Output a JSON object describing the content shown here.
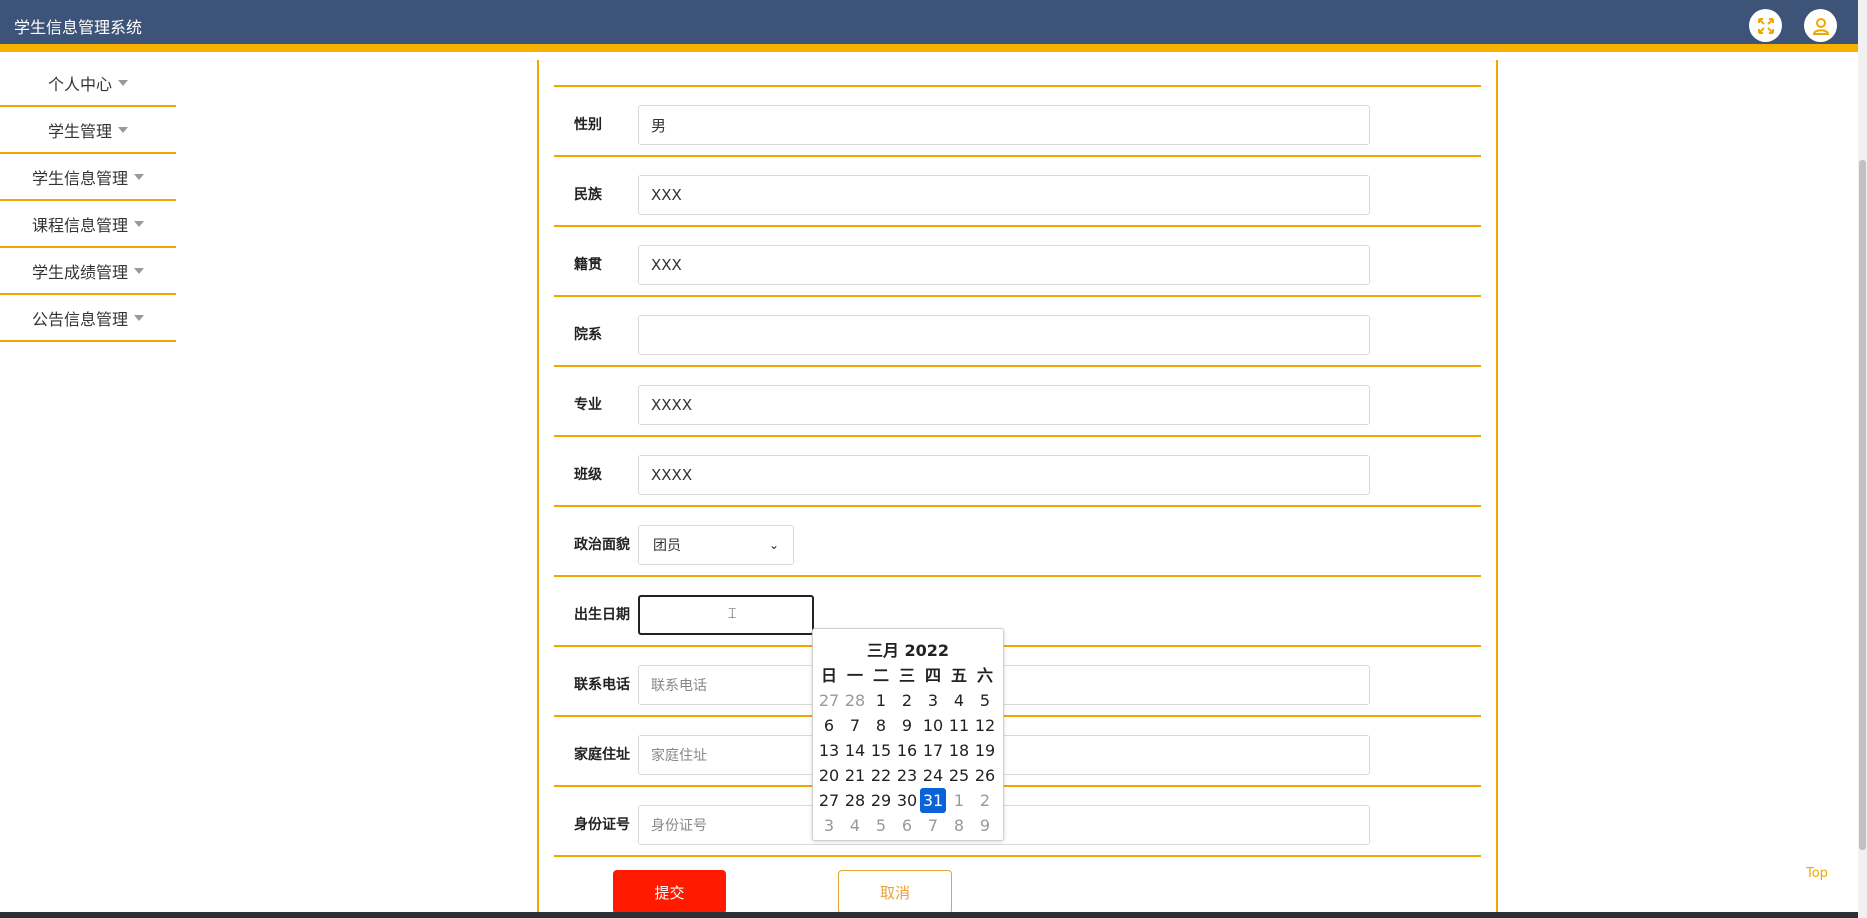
{
  "header": {
    "title": "学生信息管理系统",
    "fullscreen_icon": "fullscreen-icon",
    "user_icon": "user-icon",
    "bg_color": "#3d5478",
    "accent_color": "#f5b000"
  },
  "sidebar": {
    "items": [
      {
        "label": "个人中心"
      },
      {
        "label": "学生管理"
      },
      {
        "label": "学生信息管理"
      },
      {
        "label": "课程信息管理"
      },
      {
        "label": "学生成绩管理"
      },
      {
        "label": "公告信息管理"
      }
    ]
  },
  "form": {
    "gender": {
      "label": "性别",
      "value": "男"
    },
    "ethnicity": {
      "label": "民族",
      "value": "XXX"
    },
    "native_place": {
      "label": "籍贯",
      "value": "XXX"
    },
    "department": {
      "label": "院系",
      "value": ""
    },
    "major": {
      "label": "专业",
      "value": "XXXX"
    },
    "class": {
      "label": "班级",
      "value": "XXXX"
    },
    "political_status": {
      "label": "政治面貌",
      "selected": "团员"
    },
    "birth_date": {
      "label": "出生日期",
      "value": ""
    },
    "phone": {
      "label": "联系电话",
      "placeholder": "联系电话"
    },
    "address": {
      "label": "家庭住址",
      "placeholder": "家庭住址"
    },
    "id_number": {
      "label": "身份证号",
      "placeholder": "身份证号"
    }
  },
  "buttons": {
    "submit": "提交",
    "cancel": "取消",
    "submit_color": "#ff1a00"
  },
  "calendar": {
    "title": "三月 2022",
    "weekdays": [
      "日",
      "一",
      "二",
      "三",
      "四",
      "五",
      "六"
    ],
    "weeks": [
      [
        [
          "27",
          1
        ],
        [
          "28",
          1
        ],
        [
          "1",
          0
        ],
        [
          "2",
          0
        ],
        [
          "3",
          0
        ],
        [
          "4",
          0
        ],
        [
          "5",
          0
        ]
      ],
      [
        [
          "6",
          0
        ],
        [
          "7",
          0
        ],
        [
          "8",
          0
        ],
        [
          "9",
          0
        ],
        [
          "10",
          0
        ],
        [
          "11",
          0
        ],
        [
          "12",
          0
        ]
      ],
      [
        [
          "13",
          0
        ],
        [
          "14",
          0
        ],
        [
          "15",
          0
        ],
        [
          "16",
          0
        ],
        [
          "17",
          0
        ],
        [
          "18",
          0
        ],
        [
          "19",
          0
        ]
      ],
      [
        [
          "20",
          0
        ],
        [
          "21",
          0
        ],
        [
          "22",
          0
        ],
        [
          "23",
          0
        ],
        [
          "24",
          0
        ],
        [
          "25",
          0
        ],
        [
          "26",
          0
        ]
      ],
      [
        [
          "27",
          0
        ],
        [
          "28",
          0
        ],
        [
          "29",
          0
        ],
        [
          "30",
          0
        ],
        [
          "31",
          2
        ],
        [
          "1",
          1
        ],
        [
          "2",
          1
        ]
      ],
      [
        [
          "3",
          1
        ],
        [
          "4",
          1
        ],
        [
          "5",
          1
        ],
        [
          "6",
          1
        ],
        [
          "7",
          1
        ],
        [
          "8",
          1
        ],
        [
          "9",
          1
        ]
      ]
    ],
    "selected_color": "#0a63d8"
  },
  "footer": {
    "top_link": "Top"
  }
}
